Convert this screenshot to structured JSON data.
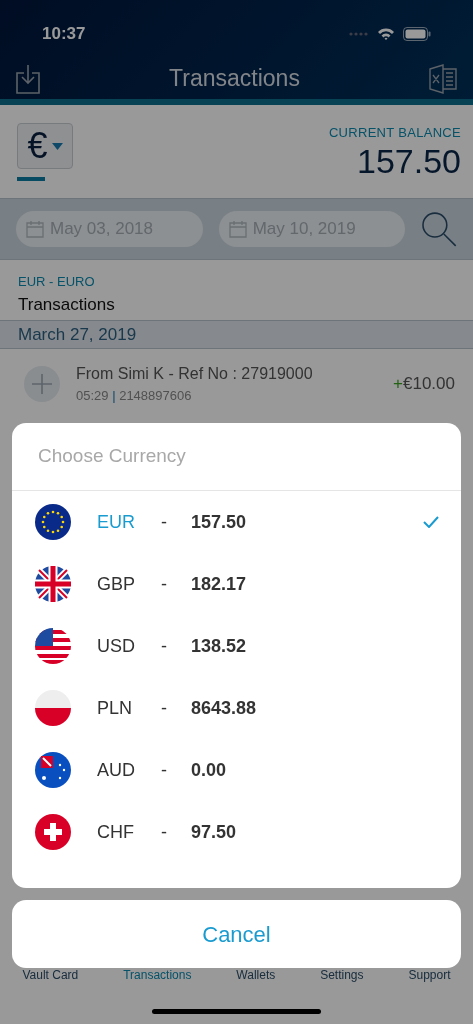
{
  "status_bar": {
    "time": "10:37"
  },
  "nav": {
    "title": "Transactions"
  },
  "balance": {
    "currency_symbol": "€",
    "label": "CURRENT BALANCE",
    "amount": "157.50"
  },
  "filter": {
    "from": "May 03, 2018",
    "to": "May 10, 2019"
  },
  "section": {
    "currency": "EUR - EURO",
    "title": "Transactions"
  },
  "date_header": "March 27, 2019",
  "transactions": [
    {
      "description": "From Simi K - Ref No : 27919000",
      "time": "05:29",
      "separator": "|",
      "reference": "2148897606",
      "sign": "+",
      "amount": "€10.00"
    }
  ],
  "sheet": {
    "title": "Choose Currency",
    "currencies": [
      {
        "code": "EUR",
        "separator": "-",
        "amount": "157.50",
        "selected": true
      },
      {
        "code": "GBP",
        "separator": "-",
        "amount": "182.17",
        "selected": false
      },
      {
        "code": "USD",
        "separator": "-",
        "amount": "138.52",
        "selected": false
      },
      {
        "code": "PLN",
        "separator": "-",
        "amount": "8643.88",
        "selected": false
      },
      {
        "code": "AUD",
        "separator": "-",
        "amount": "0.00",
        "selected": false
      },
      {
        "code": "CHF",
        "separator": "-",
        "amount": "97.50",
        "selected": false
      }
    ],
    "cancel": "Cancel"
  },
  "tab_bar": [
    {
      "label": "Vault Card",
      "selected": false
    },
    {
      "label": "Transactions",
      "selected": true
    },
    {
      "label": "Wallets",
      "selected": false
    },
    {
      "label": "Settings",
      "selected": false
    },
    {
      "label": "Support",
      "selected": false
    }
  ]
}
